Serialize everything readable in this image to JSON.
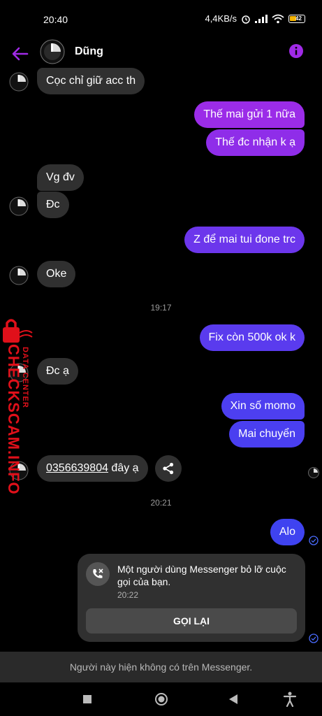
{
  "status": {
    "time": "20:40",
    "network_speed": "4,4KB/s",
    "battery": "42"
  },
  "header": {
    "contact_name": "Dũng"
  },
  "messages": {
    "m1": "Cọc chỉ giữ acc th",
    "m2": "Thế mai gửi 1 nữa",
    "m3": "Thế đc nhận k ạ",
    "m4": "Vg đv",
    "m5": "Đc",
    "m6": "Z để mai tui đone trc",
    "m7": "Oke",
    "t1": "19:17",
    "m8": "Fix còn 500k ok k",
    "m9": "Đc ạ",
    "m10": "Xin số momo",
    "m11": "Mai chuyển",
    "m12_phone": "0356639804",
    "m12_rest": " đây ạ",
    "t2": "20:21",
    "m13": "Alo"
  },
  "missed_call": {
    "message": "Một người dùng Messenger bỏ lỡ cuộc gọi của bạn.",
    "time": "20:22",
    "callback_label": "GỌI LẠI"
  },
  "footer": {
    "unavailable_notice": "Người này hiện không có trên Messenger."
  },
  "watermark": {
    "brand": "CHECKSCAM.INFO",
    "subtitle": "DATA CENTER"
  },
  "colors": {
    "accent_purple": "#8a2be2",
    "outgoing_gradient_top": "#9b2ce8",
    "outgoing_gradient_bottom": "#4a3ff0",
    "incoming_bubble": "#303030",
    "watermark_red": "#e0101a"
  },
  "icons": {
    "back": "arrow-left-icon",
    "info": "info-icon",
    "share": "share-icon",
    "missed_call": "missed-call-icon",
    "read_receipt": "check-circle-icon"
  }
}
